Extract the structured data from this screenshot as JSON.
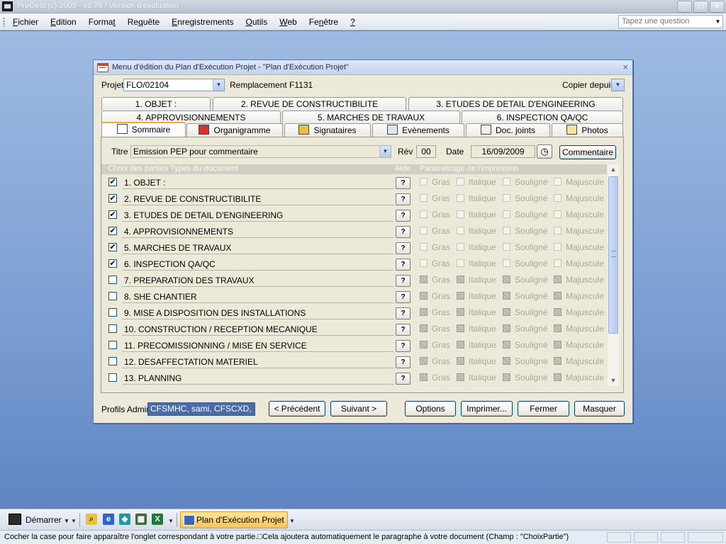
{
  "app": {
    "title": "ProGest (c) 2009 - v2.75 / Version d'évaluation",
    "menu": [
      {
        "u": "F",
        "rest": "ichier"
      },
      {
        "u": "E",
        "rest": "dition"
      },
      {
        "pre": "Forma",
        "u": "t",
        "rest": ""
      },
      {
        "pre": "Re",
        "u": "q",
        "rest": "uête"
      },
      {
        "u": "E",
        "rest": "nregistrements"
      },
      {
        "u": "O",
        "rest": "utils"
      },
      {
        "u": "W",
        "rest": "eb"
      },
      {
        "pre": "Fe",
        "u": "n",
        "rest": "être"
      },
      {
        "u": "?",
        "rest": ""
      }
    ],
    "help_placeholder": "Tapez une question"
  },
  "form": {
    "title": "Menu d'édition du Plan d'Exécution Projet - \"Plan d'Exécution Projet\"",
    "projet_label": "Projet",
    "projet_value": "FLO/02104",
    "projet_desc": "Remplacement F1131",
    "copier_label": "Copier depuis",
    "tabs_row1": [
      "1. OBJET :",
      "2. REVUE DE CONSTRUCTIBILITE",
      "3. ETUDES DE DETAIL D'ENGINEERING"
    ],
    "tabs_row2": [
      "4. APPROVISIONNEMENTS",
      "5. MARCHES DE TRAVAUX",
      "6. INSPECTION QA/QC"
    ],
    "tabs_row3": [
      "Sommaire",
      "Organigramme",
      "Signataires",
      "Evènements",
      "Doc. joints",
      "Photos"
    ],
    "titre_label": "Titre",
    "titre_value": "Emission PEP pour commentaire",
    "rev_label": "Rév",
    "rev_value": "00",
    "date_label": "Date",
    "date_value": "16/09/2009",
    "commentaire_btn": "Commentaire",
    "list_header": {
      "choix": "Choix des parties Types du document",
      "aide": "Aide",
      "param": "Paramétrage de l'impression"
    },
    "option_labels": [
      "Gras",
      "Italique",
      "Souligné",
      "Majuscule"
    ],
    "aide_label": "?",
    "parts": [
      {
        "label": "1. OBJET :",
        "checked": true
      },
      {
        "label": "2. REVUE DE CONSTRUCTIBILITE",
        "checked": true
      },
      {
        "label": "3. ETUDES DE DETAIL D'ENGINEERING",
        "checked": true
      },
      {
        "label": "4. APPROVISIONNEMENTS",
        "checked": true
      },
      {
        "label": "5. MARCHES DE TRAVAUX",
        "checked": true
      },
      {
        "label": "6. INSPECTION QA/QC",
        "checked": true
      },
      {
        "label": "7. PREPARATION DES TRAVAUX",
        "checked": false
      },
      {
        "label": "8. SHE CHANTIER",
        "checked": false
      },
      {
        "label": "9. MISE A DISPOSITION DES INSTALLATIONS",
        "checked": false
      },
      {
        "label": "10. CONSTRUCTION / RECEPTION MECANIQUE",
        "checked": false
      },
      {
        "label": "11. PRECOMISSIONNING / MISE EN SERVICE",
        "checked": false
      },
      {
        "label": "12. DESAFFECTATION MATERIEL",
        "checked": false
      },
      {
        "label": "13. PLANNING",
        "checked": false
      }
    ],
    "profils_label": "Profils Admini:",
    "profils_value": "CFSMHC, sami, CFSCXD, , der",
    "buttons": {
      "precedent": "< Précédent",
      "suivant": "Suivant >",
      "options": "Options",
      "imprimer": "Imprimer...",
      "fermer": "Fermer",
      "masquer": "Masquer"
    }
  },
  "taskbar": {
    "start_label": "Démarrer",
    "task_label": "Plan d'Exécution Projet"
  },
  "status_text": "Cocher la case pour faire apparaître l'onglet correspondant à votre partie.□Cela ajoutera automatiquement le paragraphe à votre document (Champ : \"ChoixPartie\")"
}
